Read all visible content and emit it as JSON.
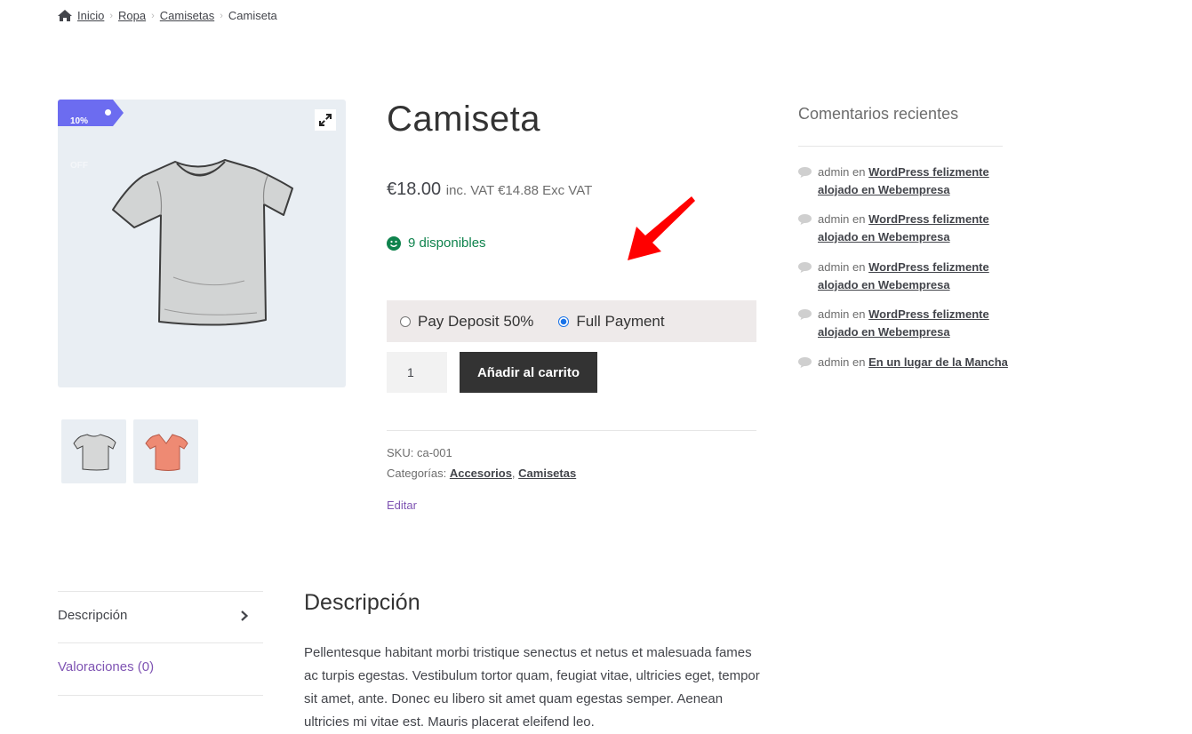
{
  "breadcrumb": {
    "items": [
      "Inicio",
      "Ropa",
      "Camisetas"
    ],
    "current": "Camiseta"
  },
  "gallery": {
    "badge_percent": "10%",
    "badge_off": "OFF",
    "thumbnails": [
      "t-shirt-grey",
      "t-shirt-coral"
    ]
  },
  "product": {
    "title": "Camiseta",
    "price": "€18.00",
    "price_suffix": "inc. VAT €14.88 Exc VAT",
    "stock": "9 disponibles",
    "deposit_options": [
      "Pay Deposit 50%",
      "Full Payment"
    ],
    "deposit_selected": "Full Payment",
    "quantity": "1",
    "add_to_cart": "Añadir al carrito",
    "sku_label": "SKU:",
    "sku": "ca-001",
    "categories_label": "Categorías:",
    "categories": [
      "Accesorios",
      "Camisetas"
    ],
    "edit": "Editar"
  },
  "sidebar": {
    "title": "Comentarios recientes",
    "comments": [
      {
        "author": "admin",
        "connector": "en",
        "post": "WordPress felizmente alojado en Webempresa"
      },
      {
        "author": "admin",
        "connector": "en",
        "post": "WordPress felizmente alojado en Webempresa"
      },
      {
        "author": "admin",
        "connector": "en",
        "post": "WordPress felizmente alojado en Webempresa"
      },
      {
        "author": "admin",
        "connector": "en",
        "post": "WordPress felizmente alojado en Webempresa"
      },
      {
        "author": "admin",
        "connector": "en",
        "post": "En un lugar de la Mancha"
      }
    ]
  },
  "tabs": {
    "items": [
      "Descripción",
      "Valoraciones (0)"
    ],
    "active": "Descripción"
  },
  "description": {
    "title": "Descripción",
    "text": "Pellentesque habitant morbi tristique senectus et netus et malesuada fames ac turpis egestas. Vestibulum tortor quam, feugiat vitae, ultricies eget, tempor sit amet, ante. Donec eu libero sit amet quam egestas semper. Aenean ultricies mi vitae est. Mauris placerat eleifend leo."
  },
  "colors": {
    "badge": "#6c6cf0",
    "stock": "#0f834d",
    "button": "#333333",
    "link_accent": "#7f54b3",
    "annotation_arrow": "#ff0000",
    "deposit_bg": "#eeeaea"
  },
  "icons": {
    "home": "home-icon",
    "zoom": "expand-icon",
    "stock": "smiley-icon",
    "comment": "speech-bubble-icon",
    "tab_arrow": "chevron-right-icon",
    "annotation": "red-arrow-icon"
  }
}
